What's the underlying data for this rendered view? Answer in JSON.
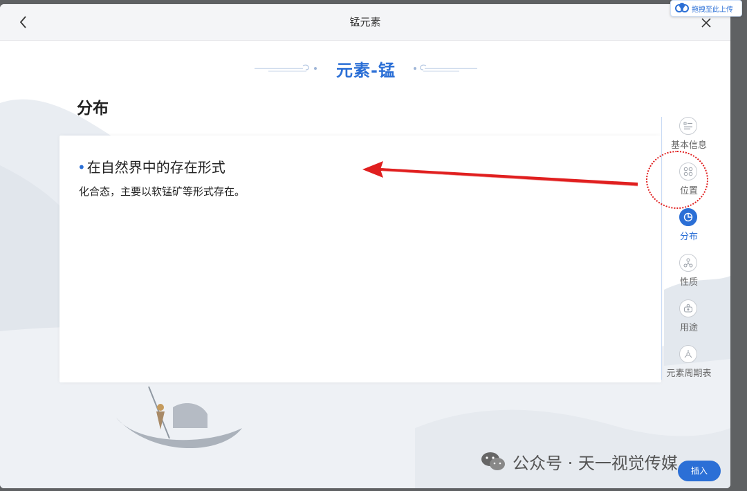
{
  "window": {
    "title": "锰元素"
  },
  "header": {
    "heading": "元素-锰"
  },
  "section": {
    "title": "分布",
    "subheading": "在自然界中的存在形式",
    "bullet": "•",
    "body": "化合态，主要以软锰矿等形式存在。"
  },
  "side_nav": {
    "items": [
      {
        "label": "基本信息",
        "icon": "list-icon",
        "active": false
      },
      {
        "label": "位置",
        "icon": "grid-icon",
        "active": false
      },
      {
        "label": "分布",
        "icon": "pie-chart-icon",
        "active": true
      },
      {
        "label": "性质",
        "icon": "molecule-icon",
        "active": false
      },
      {
        "label": "用途",
        "icon": "usage-icon",
        "active": false
      },
      {
        "label": "元素周期表",
        "icon": "periodic-table-icon",
        "active": false
      }
    ]
  },
  "buttons": {
    "insert": "插入"
  },
  "upload_badge": {
    "label": "拖拽至此上传"
  },
  "watermark": {
    "text": "公众号 · 天一视觉传媒"
  },
  "colors": {
    "accent": "#2b6fd6",
    "annotation": "#e01f1f",
    "titlebar": "#f4f5f7"
  }
}
